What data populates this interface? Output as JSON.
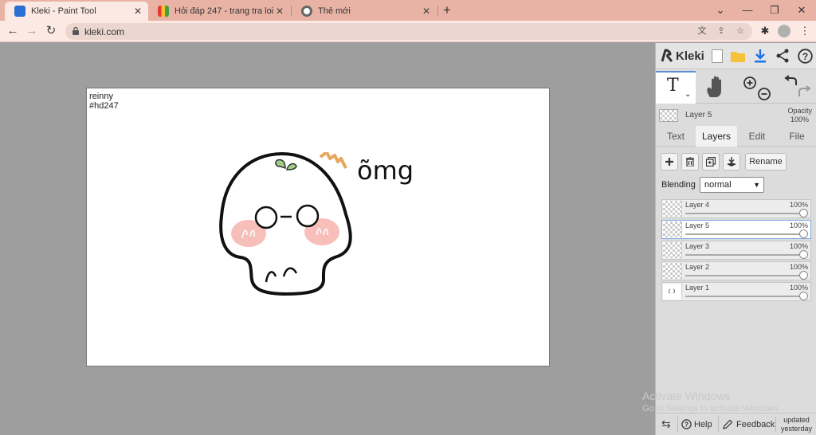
{
  "browser": {
    "tabs": [
      {
        "title": "Kleki - Paint Tool",
        "favicon_color": "#2a6fd3",
        "active": true
      },
      {
        "title": "Hỏi đáp 247 - trang tra loi",
        "favicon_color": "#f0a21a",
        "active": false
      },
      {
        "title": "Thẻ mới",
        "favicon_color": "#555555",
        "active": false
      }
    ],
    "url": "kleki.com"
  },
  "canvas": {
    "signature_line1": "reinny",
    "signature_line2": "#hd247",
    "handwriting": "õmg"
  },
  "app": {
    "logo_text": "Kleki",
    "current_layer": {
      "name": "Layer 5",
      "opacity_label": "Opacity",
      "opacity_value": "100%"
    },
    "tabs": [
      "Text",
      "Layers",
      "Edit",
      "File"
    ],
    "active_tab": "Layers",
    "rename_label": "Rename",
    "blending_label": "Blending",
    "blending_value": "normal",
    "layers": [
      {
        "name": "Layer 4",
        "opacity": "100%"
      },
      {
        "name": "Layer 5",
        "opacity": "100%",
        "selected": true
      },
      {
        "name": "Layer 3",
        "opacity": "100%"
      },
      {
        "name": "Layer 2",
        "opacity": "100%"
      },
      {
        "name": "Layer 1",
        "opacity": "100%"
      }
    ],
    "help_label": "Help",
    "feedback_label": "Feedback",
    "updated_line1": "updated",
    "updated_line2": "yesterday",
    "accent_color": "#1a73e8"
  },
  "os_watermark": {
    "line1": "Activate Windows",
    "line2": "Go to Settings to activate Windows."
  }
}
